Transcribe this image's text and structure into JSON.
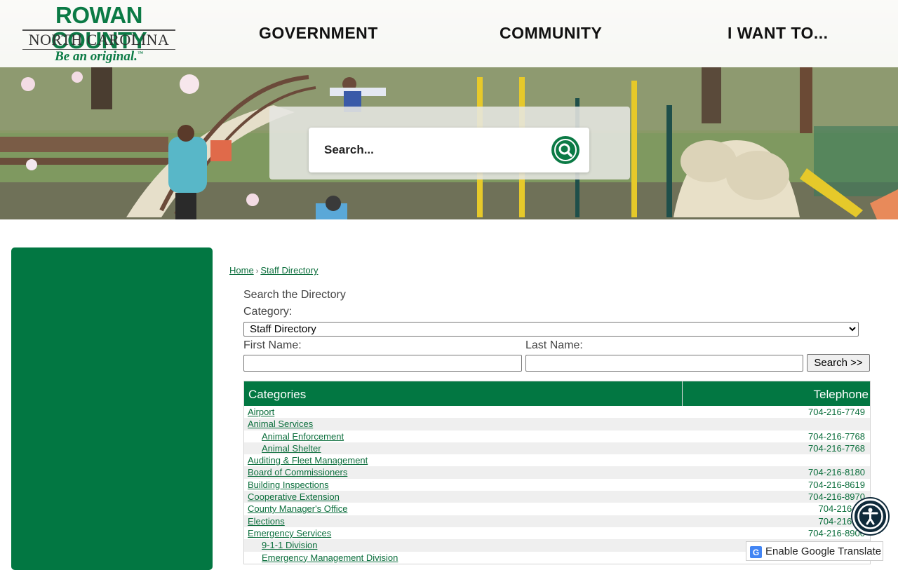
{
  "logo": {
    "main": "ROWAN COUNTY",
    "sub": "NORTH CAROLINA",
    "tagline": "Be an original.",
    "trademark": "™"
  },
  "nav": {
    "items": [
      {
        "label": "GOVERNMENT"
      },
      {
        "label": "COMMUNITY"
      },
      {
        "label": "I WANT TO..."
      }
    ]
  },
  "search": {
    "placeholder": "Search...",
    "icon": "search-icon"
  },
  "breadcrumb": {
    "items": [
      {
        "label": "Home"
      },
      {
        "label": "Staff Directory"
      }
    ],
    "separator": "›"
  },
  "directory": {
    "heading": "Search the Directory",
    "category_label": "Category:",
    "category_value": "Staff Directory",
    "first_name_label": "First Name:",
    "last_name_label": "Last Name:",
    "first_name_value": "",
    "last_name_value": "",
    "search_button": "Search >>",
    "columns": {
      "categories": "Categories",
      "telephone": "Telephone"
    },
    "rows": [
      {
        "name": "Airport",
        "phone": "704-216-7749",
        "sub": false
      },
      {
        "name": "Animal Services",
        "phone": "",
        "sub": false
      },
      {
        "name": "Animal Enforcement",
        "phone": "704-216-7768",
        "sub": true
      },
      {
        "name": "Animal Shelter",
        "phone": "704-216-7768",
        "sub": true
      },
      {
        "name": "Auditing & Fleet Management",
        "phone": "",
        "sub": false
      },
      {
        "name": "Board of Commissioners",
        "phone": "704-216-8180",
        "sub": false
      },
      {
        "name": "Building Inspections",
        "phone": "704-216-8619",
        "sub": false
      },
      {
        "name": "Cooperative Extension",
        "phone": "704-216-8970",
        "sub": false
      },
      {
        "name": "County Manager's Office",
        "phone": "704-216-81",
        "sub": false
      },
      {
        "name": "Elections",
        "phone": "704-216-81",
        "sub": false
      },
      {
        "name": "Emergency Services",
        "phone": "704-216-8900",
        "sub": false
      },
      {
        "name": "9-1-1 Division",
        "phone": "",
        "sub": true
      },
      {
        "name": "Emergency Management Division",
        "phone": "",
        "sub": true
      }
    ]
  },
  "widgets": {
    "translate_label": "Enable Google Translate",
    "accessibility_icon": "accessibility-icon"
  },
  "colors": {
    "brand_green": "#027742",
    "link_green": "#0b6e3c"
  }
}
